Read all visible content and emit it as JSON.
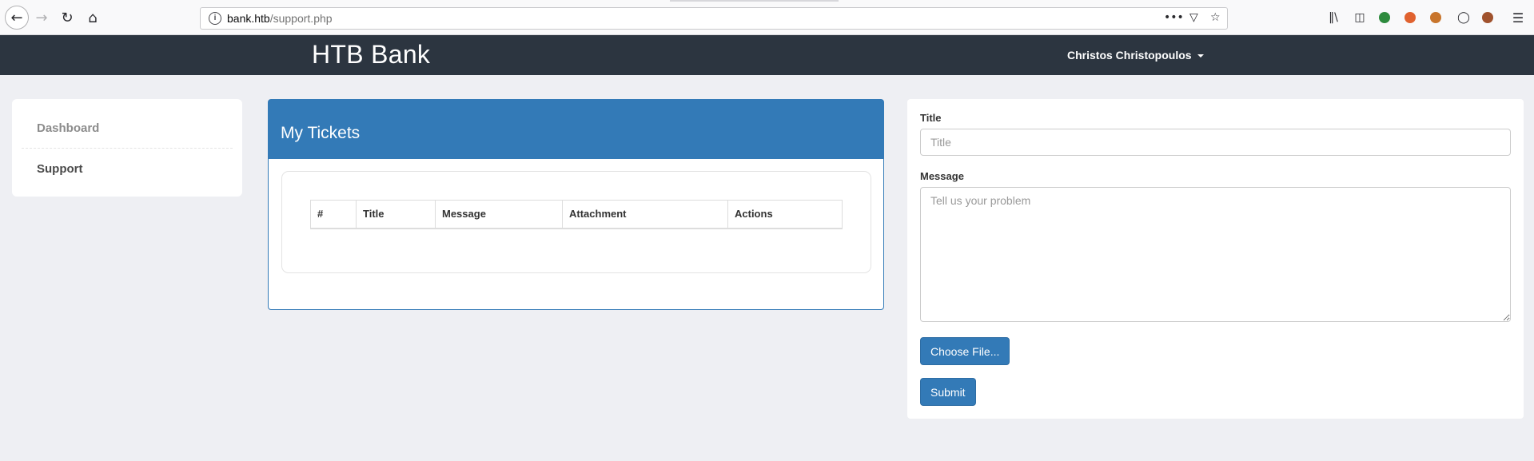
{
  "browser": {
    "url_host": "bank.htb",
    "url_path": "/support.php",
    "icons": [
      "back-icon",
      "forward-icon",
      "reload-icon",
      "home-icon",
      "info-icon",
      "more-icon",
      "pocket-icon",
      "bookmark-star-icon",
      "library-icon",
      "sidebar-icon",
      "extension-icon",
      "cookie-icon",
      "account-icon",
      "menu-icon"
    ]
  },
  "navbar": {
    "brand": "HTB Bank",
    "user": "Christos Christopoulos"
  },
  "sidebar": {
    "items": [
      {
        "label": "Dashboard"
      },
      {
        "label": "Support"
      }
    ]
  },
  "tickets": {
    "title": "My Tickets",
    "columns": [
      "#",
      "Title",
      "Message",
      "Attachment",
      "Actions"
    ],
    "rows": []
  },
  "form": {
    "title_label": "Title",
    "title_placeholder": "Title",
    "message_label": "Message",
    "message_placeholder": "Tell us your problem",
    "file_button": "Choose File...",
    "submit_button": "Submit"
  },
  "colors": {
    "navbar": "#2c3540",
    "primary": "#337ab7",
    "background": "#eeeff3"
  }
}
